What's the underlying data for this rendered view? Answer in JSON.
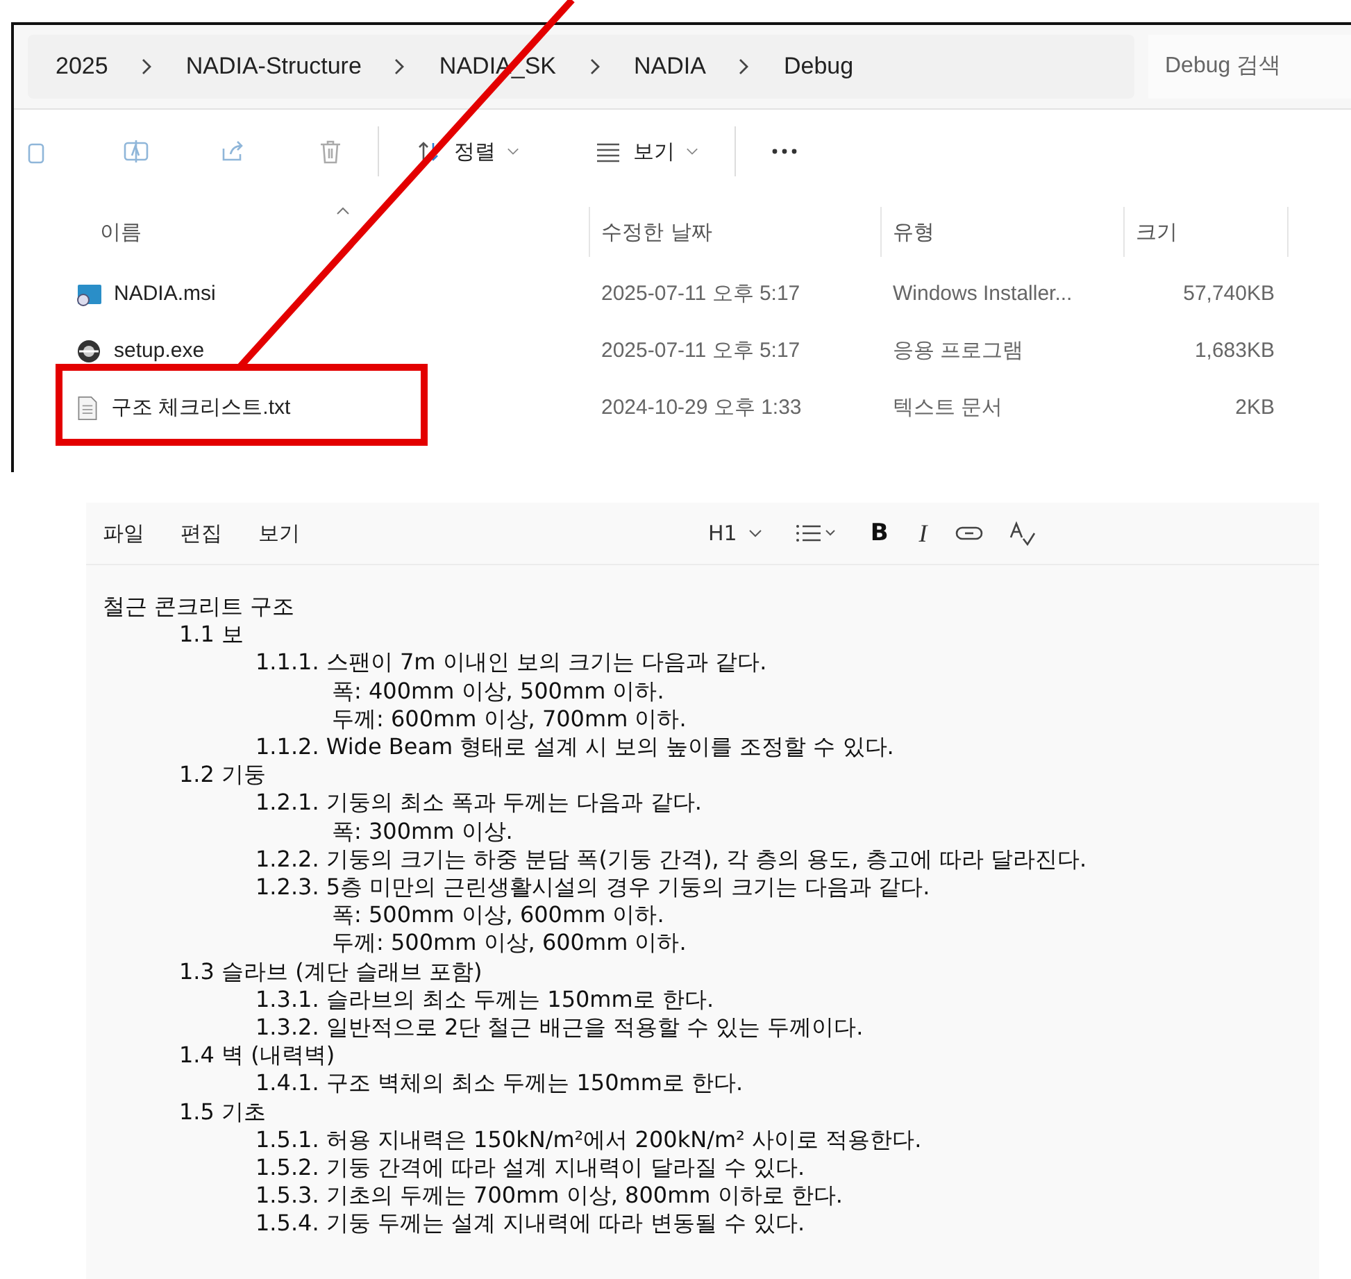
{
  "explorer": {
    "breadcrumbs": [
      "2025",
      "NADIA-Structure",
      "NADIA_SK",
      "NADIA",
      "Debug"
    ],
    "search": {
      "placeholder": "Debug 검색"
    },
    "toolbar": {
      "sort": "정렬",
      "view": "보기"
    },
    "columns": [
      "이름",
      "수정한 날짜",
      "유형",
      "크기"
    ],
    "files": [
      {
        "kind": "installer",
        "name": "NADIA.msi",
        "date": "2025-07-11 오후 5:17",
        "type": "Windows Installer...",
        "size": "57,740KB"
      },
      {
        "kind": "program",
        "name": "setup.exe",
        "date": "2025-07-11 오후 5:17",
        "type": "응용 프로그램",
        "size": "1,683KB"
      },
      {
        "kind": "text",
        "name": "구조 체크리스트.txt",
        "date": "2024-10-29 오후 1:33",
        "type": "텍스트 문서",
        "size": "2KB"
      }
    ]
  },
  "notepad": {
    "menu": [
      "파일",
      "편집",
      "보기"
    ],
    "format": {
      "heading": "H1",
      "bold": "B",
      "italic": "I"
    },
    "document": [
      {
        "text": "철근 콘크리트 구조",
        "children": [
          {
            "text": "1.1 보",
            "children": [
              {
                "text": "1.1.1. 스팬이 7m 이내인 보의 크기는 다음과 같다.",
                "children": [
                  {
                    "text": "폭: 400mm 이상, 500mm 이하."
                  },
                  {
                    "text": "두께: 600mm 이상, 700mm 이하."
                  }
                ]
              },
              {
                "text": "1.1.2. Wide Beam 형태로 설계 시 보의 높이를 조정할 수 있다."
              }
            ]
          },
          {
            "text": "1.2 기둥",
            "children": [
              {
                "text": "1.2.1. 기둥의 최소 폭과 두께는 다음과 같다.",
                "children": [
                  {
                    "text": "폭: 300mm 이상."
                  }
                ]
              },
              {
                "text": "1.2.2. 기둥의 크기는 하중 분담 폭(기둥 간격), 각 층의 용도, 층고에 따라 달라진다."
              },
              {
                "text": "1.2.3. 5층 미만의 근린생활시설의 경우 기둥의 크기는 다음과 같다.",
                "children": [
                  {
                    "text": "폭: 500mm 이상, 600mm 이하."
                  },
                  {
                    "text": "두께: 500mm 이상, 600mm 이하."
                  }
                ]
              }
            ]
          },
          {
            "text": "1.3 슬라브 (계단 슬래브 포함)",
            "children": [
              {
                "text": "1.3.1. 슬라브의 최소 두께는 150mm로 한다."
              },
              {
                "text": "1.3.2. 일반적으로 2단 철근 배근을 적용할 수 있는 두께이다."
              }
            ]
          },
          {
            "text": "1.4 벽 (내력벽)",
            "children": [
              {
                "text": "1.4.1. 구조 벽체의 최소 두께는 150mm로 한다."
              }
            ]
          },
          {
            "text": "1.5 기초",
            "children": [
              {
                "text": "1.5.1. 허용 지내력은 150kN/m²에서 200kN/m² 사이로 적용한다."
              },
              {
                "text": "1.5.2. 기둥 간격에 따라 설계 지내력이 달라질 수 있다."
              },
              {
                "text": "1.5.3. 기초의 두께는 700mm 이상, 800mm 이하로 한다."
              },
              {
                "text": "1.5.4. 기둥 두께는 설계 지내력에 따라 변동될 수 있다."
              }
            ]
          }
        ]
      }
    ]
  }
}
